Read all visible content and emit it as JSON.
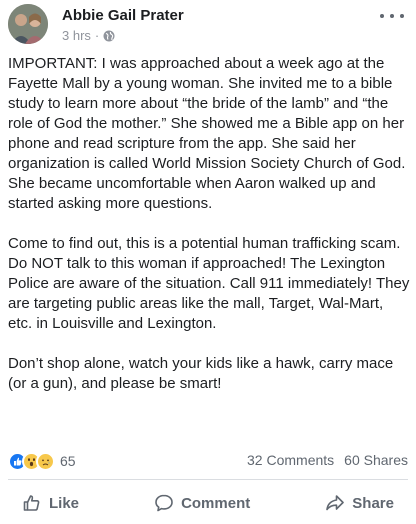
{
  "post": {
    "author": "Abbie Gail Prater",
    "time": "3 hrs",
    "separator": "·",
    "paragraphs": [
      "IMPORTANT: I was approached about a week ago at the Fayette Mall by a young woman. She invited me to a bible study to learn more about “the bride of the lamb” and “the role of God the mother.” She showed me a Bible app on her phone and read scripture from the app. She said her organization is called World Mission Society Church of God. She became uncomfortable when Aaron walked up and started asking more questions.",
      "Come to find out, this is a potential human trafficking scam. Do NOT talk to this woman if approached! The Lexington Police are aware of the situation. Call 911 immediately! They are targeting public areas like the mall, Target, Wal-Mart, etc. in Louisville and Lexington.",
      "Don’t shop alone, watch your kids like a hawk, carry mace (or a gun), and please be smart!"
    ]
  },
  "stats": {
    "reactions": [
      "like",
      "wow",
      "sad"
    ],
    "reaction_count": "65",
    "comments": "32 Comments",
    "shares": "60 Shares"
  },
  "actions": {
    "like": "Like",
    "comment": "Comment",
    "share": "Share"
  },
  "colors": {
    "like_blue": "#1877f2",
    "emoji_yellow": "#f7c84c",
    "secondary_text": "#606770"
  },
  "icons": {
    "globe": "globe-icon",
    "more": "more-options-icon",
    "like": "thumbs-up-icon",
    "comment": "speech-bubble-icon",
    "share": "share-arrow-icon"
  }
}
